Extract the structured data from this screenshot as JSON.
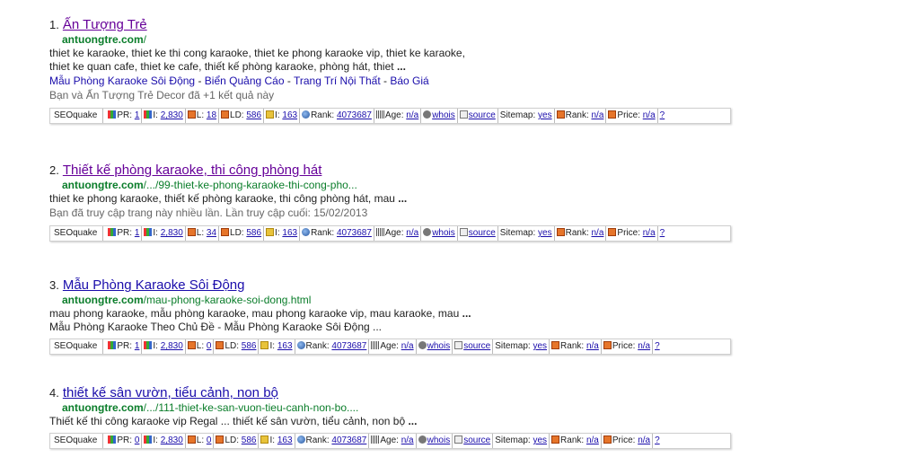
{
  "seo_labels": {
    "brand": "SEOquake",
    "pr": "PR:",
    "i": "I:",
    "l": "L:",
    "ld": "LD:",
    "i2": "I:",
    "rank": "Rank:",
    "age": "Age:",
    "whois": "whois",
    "source": "source",
    "sitemap": "Sitemap:",
    "rank2": "Rank:",
    "price": "Price:",
    "help": "?"
  },
  "results": [
    {
      "number": "1.",
      "title": "Ấn Tượng Trẻ",
      "url_bold": "antuongtre.com",
      "url_rest": "/",
      "snippet": [
        "thiet ke karaoke, thiet ke thi cong karaoke, thiet ke phong karaoke vip, thiet ke karaoke,",
        "thiet ke quan cafe, thiet ke cafe, thiết kế phòng karaoke, phòng hát, thiet "
      ],
      "snippet_end": "...",
      "sitelinks": [
        "Mẫu Phòng Karaoke Sôi Động",
        "Biển Quảng Cáo",
        "Trang Trí Nội Thất",
        "Báo Giá"
      ],
      "meta": "Bạn và Ấn Tượng Trẻ Decor đã +1 kết quả này",
      "seo": {
        "pr": "1",
        "i": "2,830",
        "l": "18",
        "ld": "586",
        "i2": "163",
        "rank": "4073687",
        "age": "n/a",
        "sitemap": "yes",
        "rank2": "n/a",
        "price": "n/a"
      }
    },
    {
      "number": "2.",
      "title": "Thiết kế phòng karaoke, thi công phòng hát",
      "url_bold": "antuongtre.com",
      "url_rest": "/.../99-thiet-ke-phong-karaoke-thi-cong-pho...",
      "snippet": [
        "thiet ke phong karaoke, thiết kế phòng karaoke, thi công phòng hát, mau "
      ],
      "snippet_end": "...",
      "meta": "Bạn đã truy cập trang này nhiều lần. Lần truy cập cuối: 15/02/2013",
      "seo": {
        "pr": "1",
        "i": "2,830",
        "l": "34",
        "ld": "586",
        "i2": "163",
        "rank": "4073687",
        "age": "n/a",
        "sitemap": "yes",
        "rank2": "n/a",
        "price": "n/a"
      }
    },
    {
      "number": "3.",
      "title": "Mẫu Phòng Karaoke Sôi Động",
      "url_bold": "antuongtre.com",
      "url_rest": "/mau-phong-karaoke-soi-dong.html",
      "snippet": [
        "mau phong karaoke, mẫu phòng karaoke, mau phong karaoke vip, mau karaoke, mau "
      ],
      "snippet_end": "...",
      "sitelinks_plain": [
        "Mẫu Phòng Karaoke Theo Chủ Đề",
        "Mẫu Phòng Karaoke Sôi Động ..."
      ],
      "seo": {
        "pr": "1",
        "i": "2,830",
        "l": "0",
        "ld": "586",
        "i2": "163",
        "rank": "4073687",
        "age": "n/a",
        "sitemap": "yes",
        "rank2": "n/a",
        "price": "n/a"
      }
    },
    {
      "number": "4.",
      "title": "thiết kế sân vườn, tiểu cảnh, non bộ",
      "url_bold": "antuongtre.com",
      "url_rest": "/.../111-thiet-ke-san-vuon-tieu-canh-non-bo....",
      "snippet": [
        "Thiết kế thi công karaoke vip Regal ... thiết kế sân vườn, tiểu cảnh, non bộ "
      ],
      "snippet_end": "...",
      "seo": {
        "pr": "0",
        "i": "2,830",
        "l": "0",
        "ld": "586",
        "i2": "163",
        "rank": "4073687",
        "age": "n/a",
        "sitemap": "yes",
        "rank2": "n/a",
        "price": "n/a"
      }
    }
  ]
}
